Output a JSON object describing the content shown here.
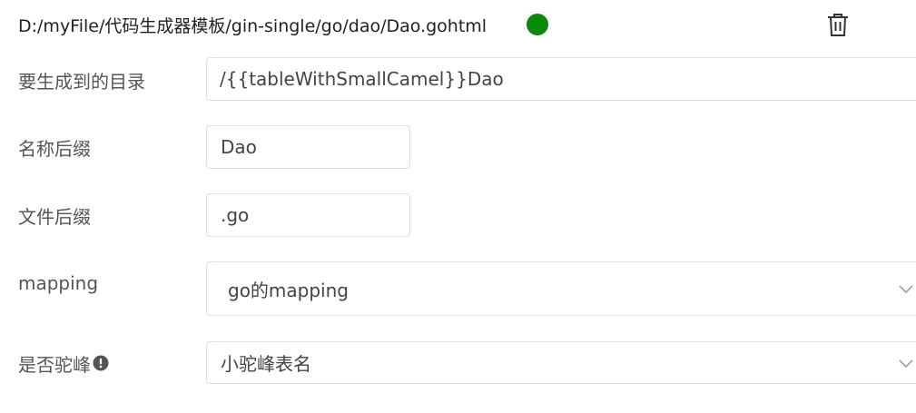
{
  "header": {
    "file_path": "D:/myFile/代码生成器模板/gin-single/go/dao/Dao.gohtml",
    "status_color": "#0a8a0a",
    "delete_icon": "trash-icon"
  },
  "form": {
    "target_dir": {
      "label": "要生成到的目录",
      "value": "/{{tableWithSmallCamel}}Dao"
    },
    "name_suffix": {
      "label": "名称后缀",
      "value": "Dao"
    },
    "file_suffix": {
      "label": "文件后缀",
      "value": ".go"
    },
    "mapping": {
      "label": "mapping",
      "value": "go的mapping"
    },
    "camel": {
      "label": "是否驼峰",
      "value": "小驼峰表名",
      "info_icon": "exclamation-circle-icon"
    }
  }
}
